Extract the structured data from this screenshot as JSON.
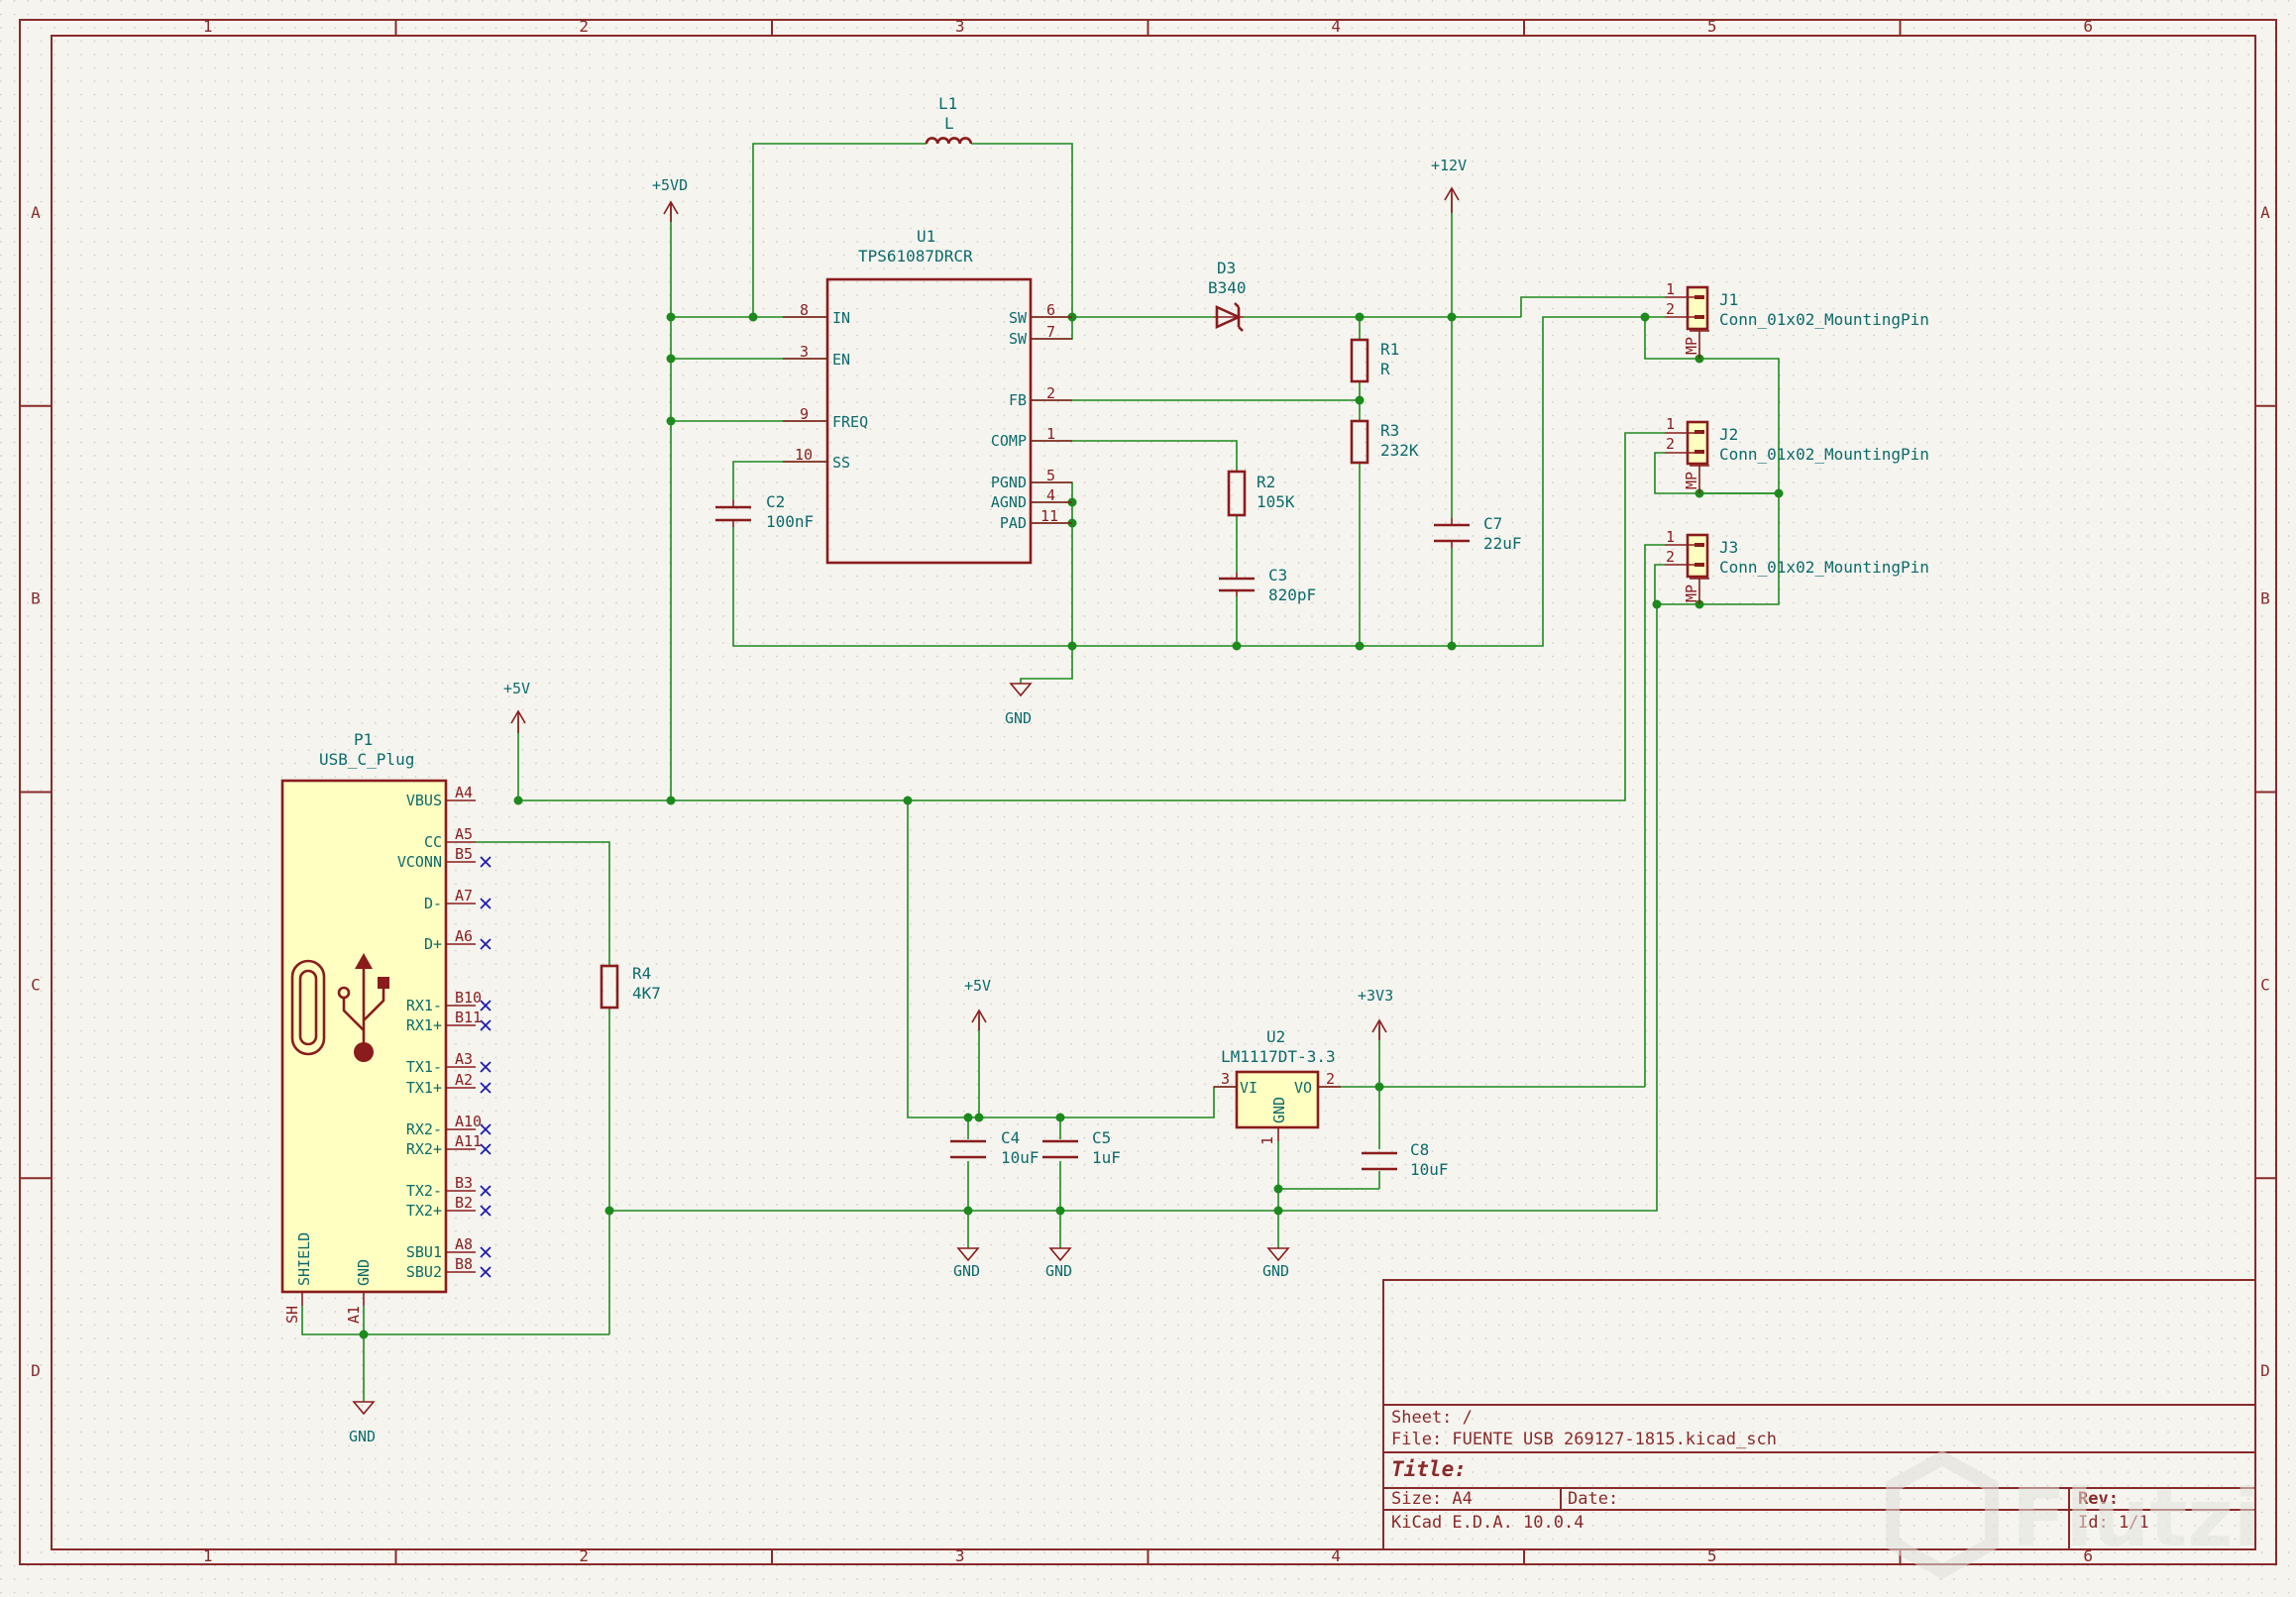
{
  "frame": {
    "columns": [
      "1",
      "2",
      "3",
      "4",
      "5",
      "6"
    ],
    "rows": [
      "A",
      "B",
      "C",
      "D"
    ]
  },
  "components": {
    "L1": {
      "ref": "L1",
      "value": "L"
    },
    "U1": {
      "ref": "U1",
      "value": "TPS61087DRCR",
      "pins_left": [
        {
          "num": "8",
          "name": "IN"
        },
        {
          "num": "3",
          "name": "EN"
        },
        {
          "num": "9",
          "name": "FREQ"
        },
        {
          "num": "10",
          "name": "SS"
        }
      ],
      "pins_right": [
        {
          "num": "6",
          "name": "SW"
        },
        {
          "num": "7",
          "name": "SW"
        },
        {
          "num": "2",
          "name": "FB"
        },
        {
          "num": "1",
          "name": "COMP"
        },
        {
          "num": "5",
          "name": "PGND"
        },
        {
          "num": "4",
          "name": "AGND"
        },
        {
          "num": "11",
          "name": "PAD"
        }
      ]
    },
    "D3": {
      "ref": "D3",
      "value": "B340"
    },
    "R1": {
      "ref": "R1",
      "value": "R"
    },
    "R3": {
      "ref": "R3",
      "value": "232K"
    },
    "R2": {
      "ref": "R2",
      "value": "105K"
    },
    "C3": {
      "ref": "C3",
      "value": "820pF"
    },
    "C2": {
      "ref": "C2",
      "value": "100nF"
    },
    "C7": {
      "ref": "C7",
      "value": "22uF"
    },
    "J1": {
      "ref": "J1",
      "value": "Conn_01x02_MountingPin"
    },
    "J2": {
      "ref": "J2",
      "value": "Conn_01x02_MountingPin"
    },
    "J3": {
      "ref": "J3",
      "value": "Conn_01x02_MountingPin"
    },
    "conn_pins": {
      "p1": "1",
      "p2": "2",
      "mp": "MP"
    },
    "P1": {
      "ref": "P1",
      "value": "USB_C_Plug",
      "pins": [
        {
          "name": "VBUS",
          "num": "A4"
        },
        {
          "name": "CC",
          "num": "A5"
        },
        {
          "name": "VCONN",
          "num": "B5"
        },
        {
          "name": "D-",
          "num": "A7"
        },
        {
          "name": "D+",
          "num": "A6"
        },
        {
          "name": "RX1-",
          "num": "B10"
        },
        {
          "name": "RX1+",
          "num": "B11"
        },
        {
          "name": "TX1-",
          "num": "A3"
        },
        {
          "name": "TX1+",
          "num": "A2"
        },
        {
          "name": "RX2-",
          "num": "A10"
        },
        {
          "name": "RX2+",
          "num": "A11"
        },
        {
          "name": "TX2-",
          "num": "B3"
        },
        {
          "name": "TX2+",
          "num": "B2"
        },
        {
          "name": "SBU1",
          "num": "A8"
        },
        {
          "name": "SBU2",
          "num": "B8"
        }
      ],
      "shield": "SHIELD",
      "gnd": "GND",
      "sh_pin": "SH",
      "gnd_pin": "A1"
    },
    "R4": {
      "ref": "R4",
      "value": "4K7"
    },
    "C4": {
      "ref": "C4",
      "value": "10uF"
    },
    "C5": {
      "ref": "C5",
      "value": "1uF"
    },
    "U2": {
      "ref": "U2",
      "value": "LM1117DT-3.3",
      "vi": "VI",
      "vo": "VO",
      "gnd": "GND",
      "pin_vi": "3",
      "pin_vo": "2",
      "pin_gnd": "1"
    },
    "C8": {
      "ref": "C8",
      "value": "10uF"
    }
  },
  "power": {
    "p5vd": "+5VD",
    "p12v": "+12V",
    "p5v_a": "+5V",
    "p5v_b": "+5V",
    "p3v3": "+3V3",
    "gnd_u1": "GND",
    "gnd_usb": "GND",
    "gnd_c4": "GND",
    "gnd_c5": "GND",
    "gnd_u2": "GND"
  },
  "title_block": {
    "sheet": "Sheet: /",
    "file": "File: FUENTE USB 269127-1815.kicad_sch",
    "title": "Title:",
    "size": "Size: A4",
    "date": "Date:",
    "rev": "Rev:",
    "tool": "KiCad E.D.A. 10.0.4",
    "id": "Id: 1/1"
  },
  "watermark": "Flutzi"
}
